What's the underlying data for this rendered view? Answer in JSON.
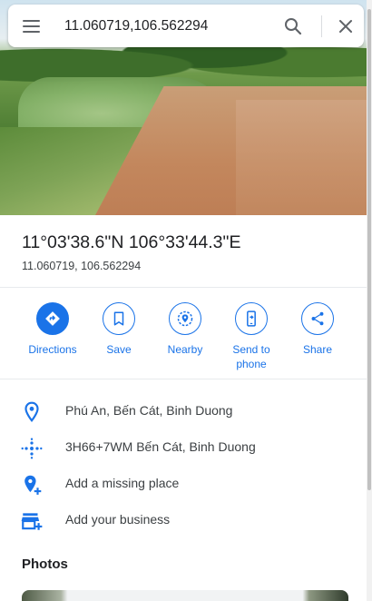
{
  "search": {
    "value": "11.060719,106.562294"
  },
  "place": {
    "title": "11°03'38.6\"N 106°33'44.3\"E",
    "decimal": "11.060719, 106.562294"
  },
  "actions": [
    {
      "label": "Directions",
      "icon": "directions-icon"
    },
    {
      "label": "Save",
      "icon": "bookmark-icon"
    },
    {
      "label": "Nearby",
      "icon": "nearby-icon"
    },
    {
      "label": "Send to phone",
      "icon": "phone-icon"
    },
    {
      "label": "Share",
      "icon": "share-icon"
    }
  ],
  "info": [
    {
      "text": "Phú An, Bến Cát, Binh Duong",
      "icon": "location-pin-icon"
    },
    {
      "text": "3H66+7WM Bến Cát, Binh Duong",
      "icon": "plus-code-icon"
    },
    {
      "text": "Add a missing place",
      "icon": "add-place-icon"
    },
    {
      "text": "Add your business",
      "icon": "add-business-icon"
    }
  ],
  "photos": {
    "heading": "Photos"
  },
  "colors": {
    "accent": "#1a73e8",
    "text": "#202124"
  }
}
